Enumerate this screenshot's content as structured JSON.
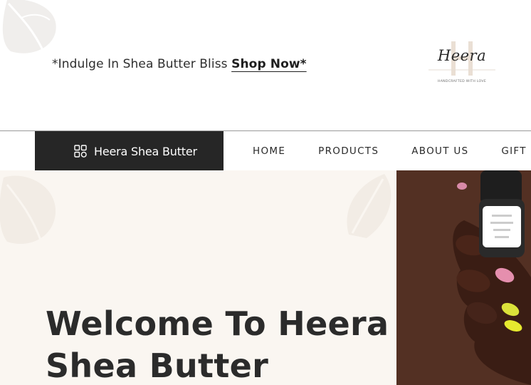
{
  "announcement": {
    "text": "*Indulge In Shea Butter Bliss ",
    "link_text": "Shop Now*"
  },
  "logo": {
    "brand": "Heera",
    "tagline": "HANDCRAFTED WITH LOVE",
    "monogram": "H"
  },
  "nav": {
    "brand_button_label": "Heera Shea Butter",
    "brand_button_icon": "grid-icon",
    "items": [
      "HOME",
      "PRODUCTS",
      "ABOUT US",
      "GIFT CA"
    ]
  },
  "hero": {
    "title_line1": "Welcome To Heera",
    "title_line2": "Shea Butter"
  },
  "colors": {
    "dark": "#262626",
    "hero_bg": "#faf6f1",
    "photo_bg": "#5a3527"
  }
}
